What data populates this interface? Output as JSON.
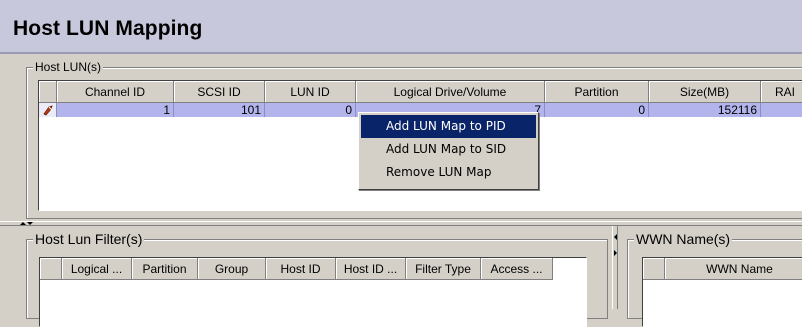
{
  "page_title": "Host LUN Mapping",
  "host_lun": {
    "title": "Host LUN(s)",
    "columns": [
      "",
      "Channel ID",
      "SCSI ID",
      "LUN ID",
      "Logical Drive/Volume",
      "Partition",
      "Size(MB)",
      "RAI"
    ],
    "rows": [
      {
        "icon": "drive-icon",
        "channel_id": "1",
        "scsi_id": "101",
        "lun_id": "0",
        "logical_drive": "7",
        "partition": "0",
        "size_mb": "152116",
        "raid": ""
      }
    ]
  },
  "context_menu": {
    "items": [
      "Add LUN Map to PID",
      "Add LUN Map to SID",
      "Remove LUN Map"
    ],
    "active_index": 0
  },
  "host_lun_filter": {
    "title": "Host Lun Filter(s)",
    "columns": [
      "",
      "Logical ...",
      "Partition",
      "Group",
      "Host ID",
      "Host ID ...",
      "Filter Type",
      "Access ..."
    ]
  },
  "wwn_names": {
    "title": "WWN Name(s)",
    "columns": [
      "",
      "WWN Name"
    ]
  },
  "colors": {
    "header_bg": "#c8c8dc",
    "row_selected": "#b4b4ec",
    "menu_highlight": "#0a246a",
    "panel_bg": "#d4d0c8"
  }
}
